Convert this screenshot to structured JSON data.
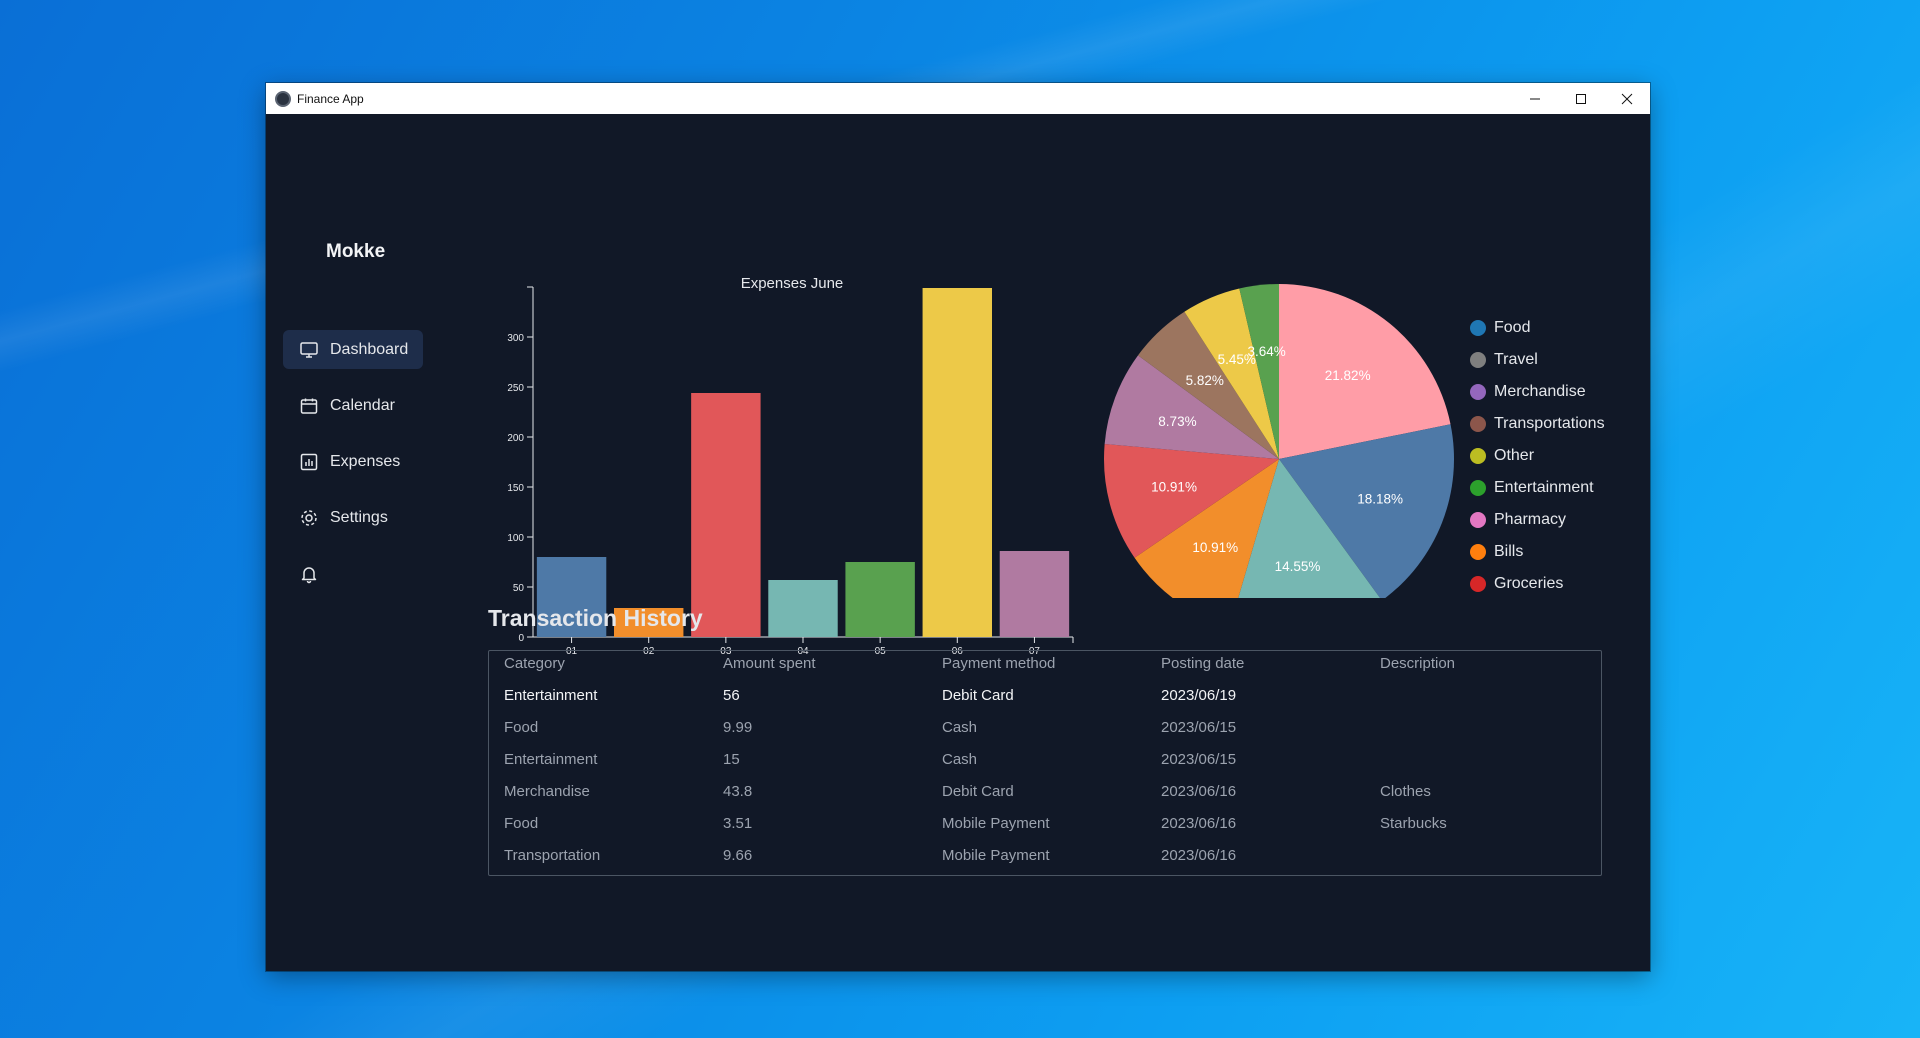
{
  "window": {
    "title": "Finance App"
  },
  "sidebar": {
    "brand": "Mokke",
    "items": [
      {
        "label": "Dashboard",
        "icon": "monitor-icon",
        "active": true
      },
      {
        "label": "Calendar",
        "icon": "calendar-icon",
        "active": false
      },
      {
        "label": "Expenses",
        "icon": "bar-chart-icon",
        "active": false
      },
      {
        "label": "Settings",
        "icon": "gear-icon",
        "active": false
      },
      {
        "label": "",
        "icon": "bell-icon",
        "active": false
      }
    ]
  },
  "chart_data": [
    {
      "type": "bar",
      "title": "Expenses June",
      "categories": [
        "01",
        "02",
        "03",
        "04",
        "05",
        "06",
        "07"
      ],
      "values": [
        80,
        29,
        244,
        57,
        75,
        349,
        86
      ],
      "colors": [
        "#4e79a7",
        "#f28e2b",
        "#e15759",
        "#76b7b2",
        "#59a14f",
        "#edc948",
        "#b07aa1"
      ],
      "yticks": [
        0,
        50,
        100,
        150,
        200,
        250,
        300
      ],
      "ylim": [
        0,
        350
      ]
    },
    {
      "type": "pie",
      "slices": [
        {
          "label": "21.82%",
          "value": 21.82,
          "color": "#ff9da7"
        },
        {
          "label": "18.18%",
          "value": 18.18,
          "color": "#4e79a7"
        },
        {
          "label": "14.55%",
          "value": 14.55,
          "color": "#76b7b2"
        },
        {
          "label": "10.91%",
          "value": 10.91,
          "color": "#f28e2b"
        },
        {
          "label": "10.91%",
          "value": 10.91,
          "color": "#e15759"
        },
        {
          "label": "8.73%",
          "value": 8.73,
          "color": "#b07aa1"
        },
        {
          "label": "5.82%",
          "value": 5.82,
          "color": "#9c755f"
        },
        {
          "label": "5.45%",
          "value": 5.45,
          "color": "#edc948"
        },
        {
          "label": "3.64%",
          "value": 3.64,
          "color": "#59a14f"
        }
      ],
      "legend": [
        {
          "label": "Food",
          "color": "#1f77b4"
        },
        {
          "label": "Travel",
          "color": "#7f7f7f"
        },
        {
          "label": "Merchandise",
          "color": "#9467bd"
        },
        {
          "label": "Transportations",
          "color": "#8c564b"
        },
        {
          "label": "Other",
          "color": "#bcbd22"
        },
        {
          "label": "Entertainment",
          "color": "#2ca02c"
        },
        {
          "label": "Pharmacy",
          "color": "#e377c2"
        },
        {
          "label": "Bills",
          "color": "#ff7f0e"
        },
        {
          "label": "Groceries",
          "color": "#d62728"
        }
      ],
      "legend_position": "right"
    }
  ],
  "transactions": {
    "title": "Transaction History",
    "columns": [
      "Category",
      "Amount spent",
      "Payment method",
      "Posting date",
      "Description"
    ],
    "rows": [
      [
        "Entertainment",
        "56",
        "Debit Card",
        "2023/06/19",
        ""
      ],
      [
        "Food",
        "9.99",
        "Cash",
        "2023/06/15",
        ""
      ],
      [
        "Entertainment",
        "15",
        "Cash",
        "2023/06/15",
        ""
      ],
      [
        "Merchandise",
        "43.8",
        "Debit Card",
        "2023/06/16",
        "Clothes"
      ],
      [
        "Food",
        "3.51",
        "Mobile Payment",
        "2023/06/16",
        "Starbucks"
      ],
      [
        "Transportation",
        "9.66",
        "Mobile Payment",
        "2023/06/16",
        ""
      ]
    ]
  }
}
